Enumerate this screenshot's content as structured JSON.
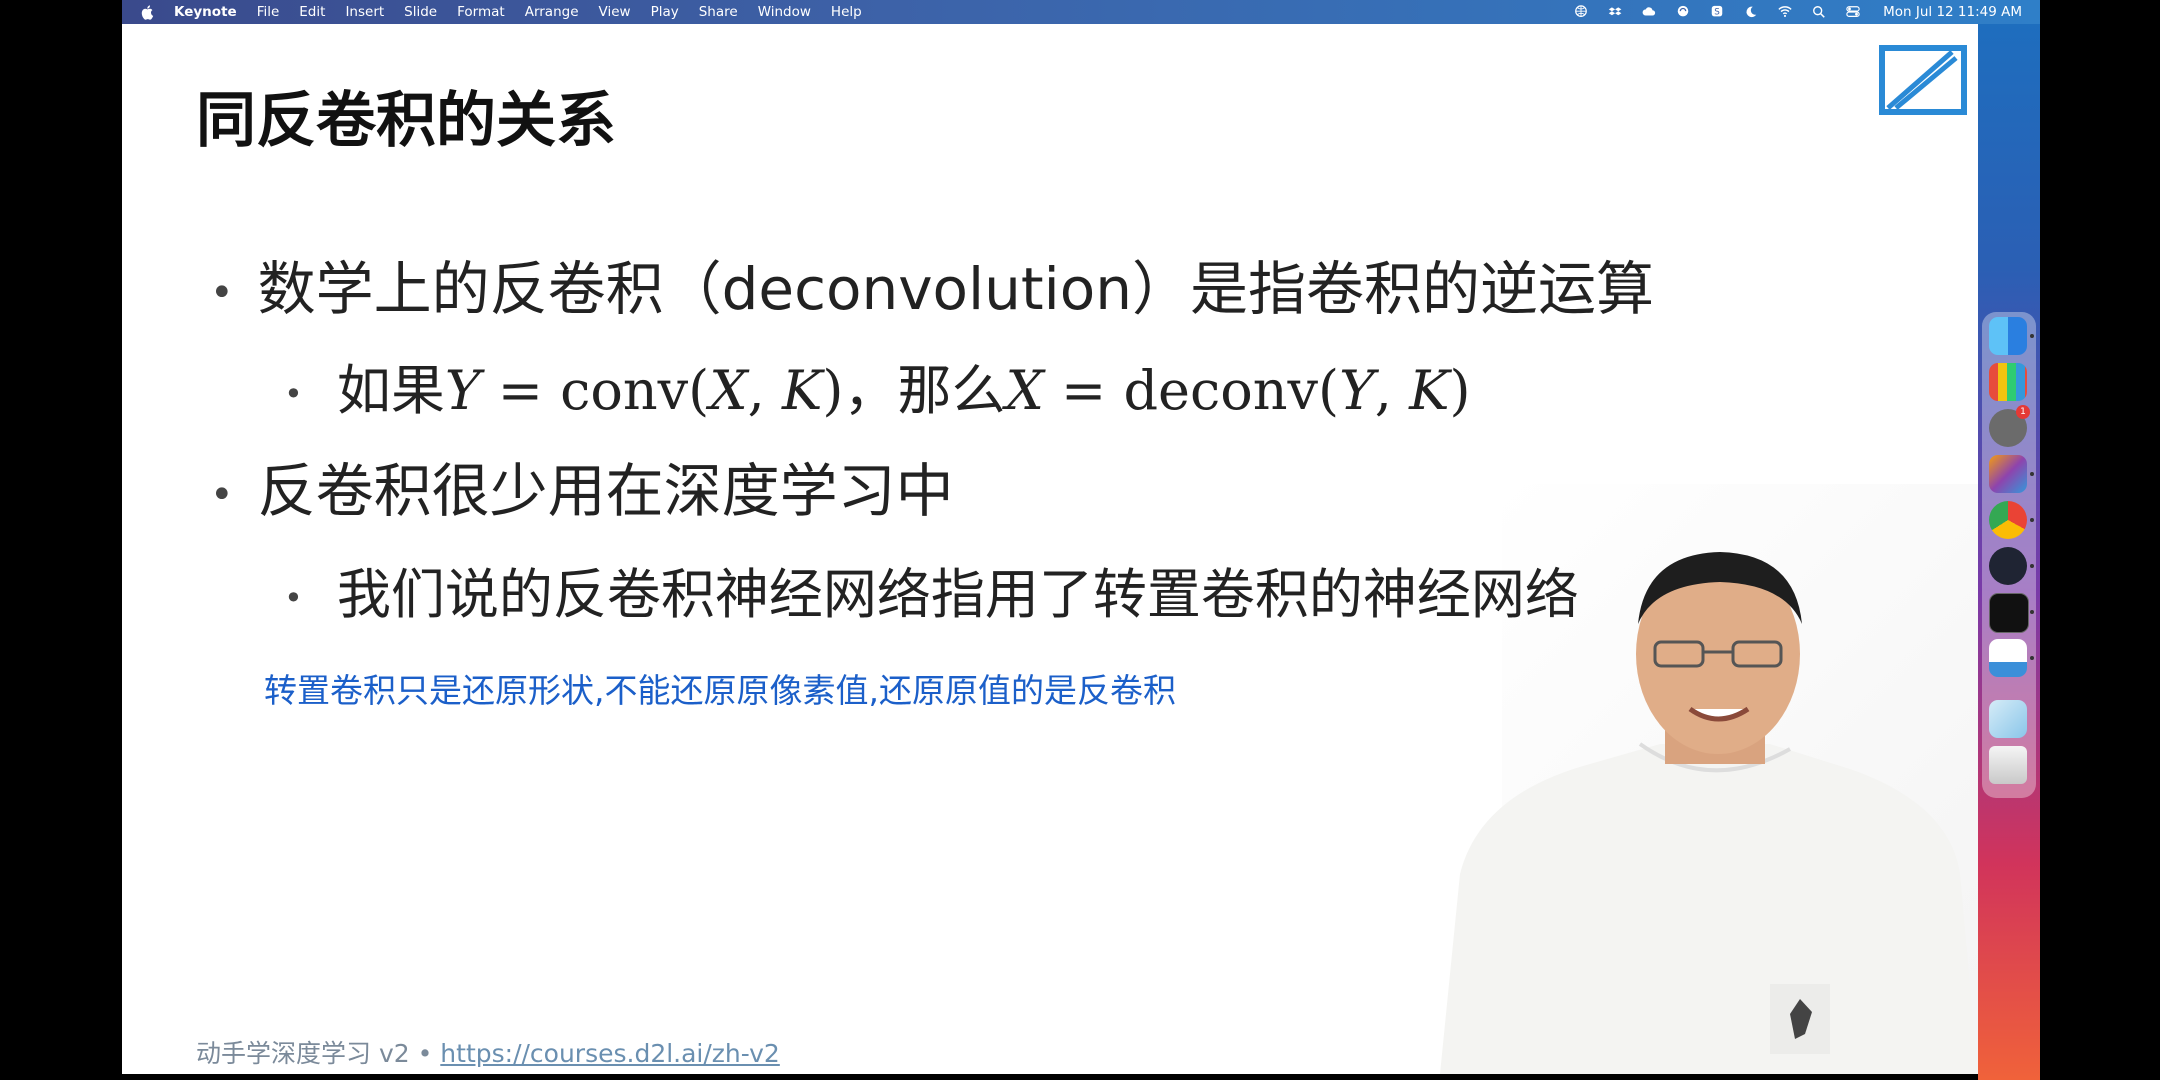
{
  "menubar": {
    "app_name": "Keynote",
    "items": [
      "File",
      "Edit",
      "Insert",
      "Slide",
      "Format",
      "Arrange",
      "View",
      "Play",
      "Share",
      "Window",
      "Help"
    ],
    "clock": "Mon Jul 12  11:49 AM",
    "status_icons": [
      "globe-icon",
      "dropbox-icon",
      "cloud-icon",
      "sync-icon",
      "s-app-icon",
      "moon-icon",
      "wifi-icon",
      "search-icon",
      "control-center-icon"
    ]
  },
  "slide": {
    "title": "同反卷积的关系",
    "bullet1": {
      "before": "数学上的反卷积（deconvolution）是指卷积的逆运算"
    },
    "bullet2": {
      "text1": "如果",
      "Y": "Y",
      "eq1": " = conv(",
      "X": "X",
      "comma1": ", ",
      "K": "K",
      "close1": ")",
      "text2": "，那么",
      "X2": "X",
      "eq2": " = deconv(",
      "Y2": "Y",
      "comma2": ", ",
      "K2": "K",
      "close2": ")"
    },
    "bullet3": "反卷积很少用在深度学习中",
    "bullet4": "我们说的反卷积神经网络指用了转置卷积的神经网络",
    "note": "转置卷积只是还原形状,不能还原原像素值,还原原值的是反卷积",
    "footer_text": "动手学深度学习 v2 • ",
    "footer_link": "https://courses.d2l.ai/zh-v2"
  },
  "dock": {
    "icons": [
      "finder-icon",
      "launchpad-icon",
      "system-preferences-icon",
      "final-cut-icon",
      "chrome-icon",
      "obs-icon",
      "terminal-icon",
      "keynote-icon",
      "preview-icon",
      "trash-icon"
    ],
    "badge": "1"
  },
  "colors": {
    "note_blue": "#1b5fc9",
    "footer_gray": "#7b8a9a"
  }
}
